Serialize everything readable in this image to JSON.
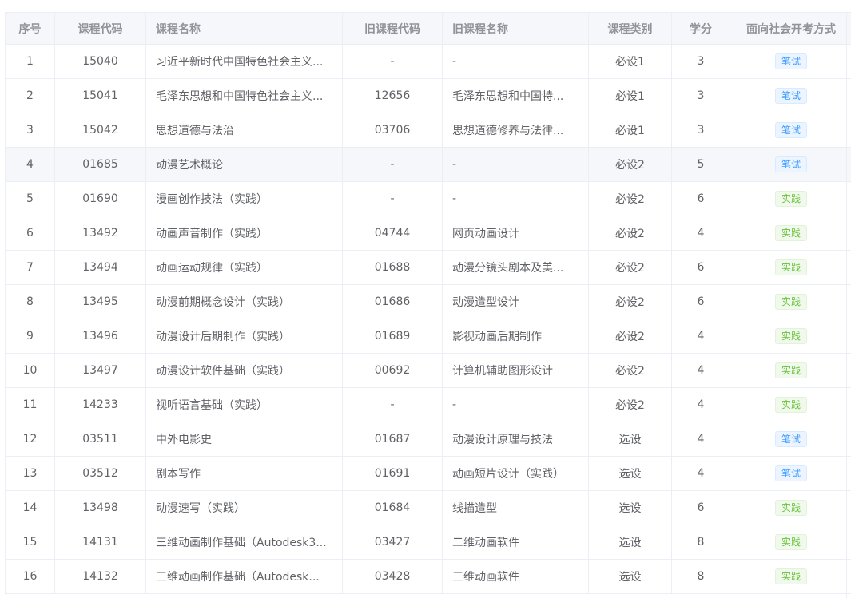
{
  "columns": [
    "序号",
    "课程代码",
    "课程名称",
    "旧课程代码",
    "旧课程名称",
    "课程类别",
    "学分",
    "面向社会开考方式"
  ],
  "rows": [
    {
      "no": "1",
      "code": "15040",
      "name": "习近平新时代中国特色社会主义...",
      "old_code": "-",
      "old_name": "-",
      "type": "必设1",
      "credit": "3",
      "exam": "笔试",
      "exam_kind": "written"
    },
    {
      "no": "2",
      "code": "15041",
      "name": "毛泽东思想和中国特色社会主义...",
      "old_code": "12656",
      "old_name": "毛泽东思想和中国特...",
      "type": "必设1",
      "credit": "3",
      "exam": "笔试",
      "exam_kind": "written"
    },
    {
      "no": "3",
      "code": "15042",
      "name": "思想道德与法治",
      "old_code": "03706",
      "old_name": "思想道德修养与法律...",
      "type": "必设1",
      "credit": "3",
      "exam": "笔试",
      "exam_kind": "written"
    },
    {
      "no": "4",
      "code": "01685",
      "name": "动漫艺术概论",
      "old_code": "-",
      "old_name": "-",
      "type": "必设2",
      "credit": "5",
      "exam": "笔试",
      "exam_kind": "written"
    },
    {
      "no": "5",
      "code": "01690",
      "name": "漫画创作技法（实践）",
      "old_code": "-",
      "old_name": "-",
      "type": "必设2",
      "credit": "6",
      "exam": "实践",
      "exam_kind": "practice"
    },
    {
      "no": "6",
      "code": "13492",
      "name": "动画声音制作（实践）",
      "old_code": "04744",
      "old_name": "网页动画设计",
      "type": "必设2",
      "credit": "4",
      "exam": "实践",
      "exam_kind": "practice"
    },
    {
      "no": "7",
      "code": "13494",
      "name": "动画运动规律（实践）",
      "old_code": "01688",
      "old_name": "动漫分镜头剧本及美...",
      "type": "必设2",
      "credit": "6",
      "exam": "实践",
      "exam_kind": "practice"
    },
    {
      "no": "8",
      "code": "13495",
      "name": "动漫前期概念设计（实践）",
      "old_code": "01686",
      "old_name": "动漫造型设计",
      "type": "必设2",
      "credit": "6",
      "exam": "实践",
      "exam_kind": "practice"
    },
    {
      "no": "9",
      "code": "13496",
      "name": "动漫设计后期制作（实践）",
      "old_code": "01689",
      "old_name": "影视动画后期制作",
      "type": "必设2",
      "credit": "4",
      "exam": "实践",
      "exam_kind": "practice"
    },
    {
      "no": "10",
      "code": "13497",
      "name": "动漫设计软件基础（实践）",
      "old_code": "00692",
      "old_name": "计算机辅助图形设计",
      "type": "必设2",
      "credit": "4",
      "exam": "实践",
      "exam_kind": "practice"
    },
    {
      "no": "11",
      "code": "14233",
      "name": "视听语言基础（实践）",
      "old_code": "-",
      "old_name": "-",
      "type": "必设2",
      "credit": "4",
      "exam": "实践",
      "exam_kind": "practice"
    },
    {
      "no": "12",
      "code": "03511",
      "name": "中外电影史",
      "old_code": "01687",
      "old_name": "动漫设计原理与技法",
      "type": "选设",
      "credit": "4",
      "exam": "笔试",
      "exam_kind": "written"
    },
    {
      "no": "13",
      "code": "03512",
      "name": "剧本写作",
      "old_code": "01691",
      "old_name": "动画短片设计（实践）",
      "type": "选设",
      "credit": "4",
      "exam": "笔试",
      "exam_kind": "written"
    },
    {
      "no": "14",
      "code": "13498",
      "name": "动漫速写（实践）",
      "old_code": "01684",
      "old_name": "线描造型",
      "type": "选设",
      "credit": "6",
      "exam": "实践",
      "exam_kind": "practice"
    },
    {
      "no": "15",
      "code": "14131",
      "name": "三维动画制作基础（Autodesk3...",
      "old_code": "03427",
      "old_name": "二维动画软件",
      "type": "选设",
      "credit": "8",
      "exam": "实践",
      "exam_kind": "practice"
    },
    {
      "no": "16",
      "code": "14132",
      "name": "三维动画制作基础（Autodesk...",
      "old_code": "03428",
      "old_name": "三维动画软件",
      "type": "选设",
      "credit": "8",
      "exam": "实践",
      "exam_kind": "practice"
    }
  ],
  "colors": {
    "written_tag": "#409eff",
    "practice_tag": "#67c23a",
    "header_bg": "#f5f7fa",
    "border": "#ebeef5"
  }
}
